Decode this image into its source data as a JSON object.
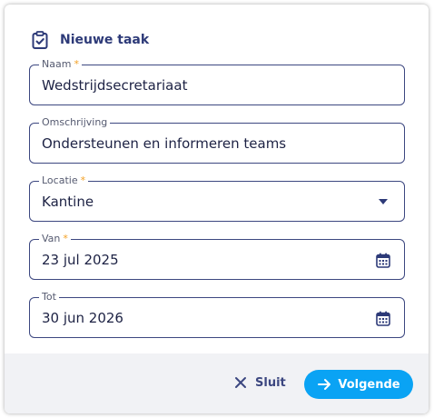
{
  "dialog": {
    "title": "Nieuwe taak",
    "title_icon": "clipboard-check-icon"
  },
  "fields": {
    "naam": {
      "label": "Naam",
      "required": "*",
      "value": "Wedstrijdsecretariaat"
    },
    "omschrijving": {
      "label": "Omschrijving",
      "value": "Ondersteunen en informeren teams"
    },
    "locatie": {
      "label": "Locatie",
      "required": "*",
      "value": "Kantine",
      "icon": "caret-down-icon"
    },
    "van": {
      "label": "Van",
      "required": "*",
      "value": "23 jul 2025",
      "icon": "calendar-icon"
    },
    "tot": {
      "label": "Tot",
      "value": "30 jun 2026",
      "icon": "calendar-icon"
    }
  },
  "footer": {
    "close_label": "Sluit",
    "close_icon": "close-icon",
    "next_label": "Volgende",
    "next_icon": "arrow-right-icon"
  },
  "colors": {
    "primary_dark": "#2d3a78",
    "accent": "#0aa3f4",
    "required": "#f3a024",
    "footer_bg": "#f1f2f5"
  }
}
